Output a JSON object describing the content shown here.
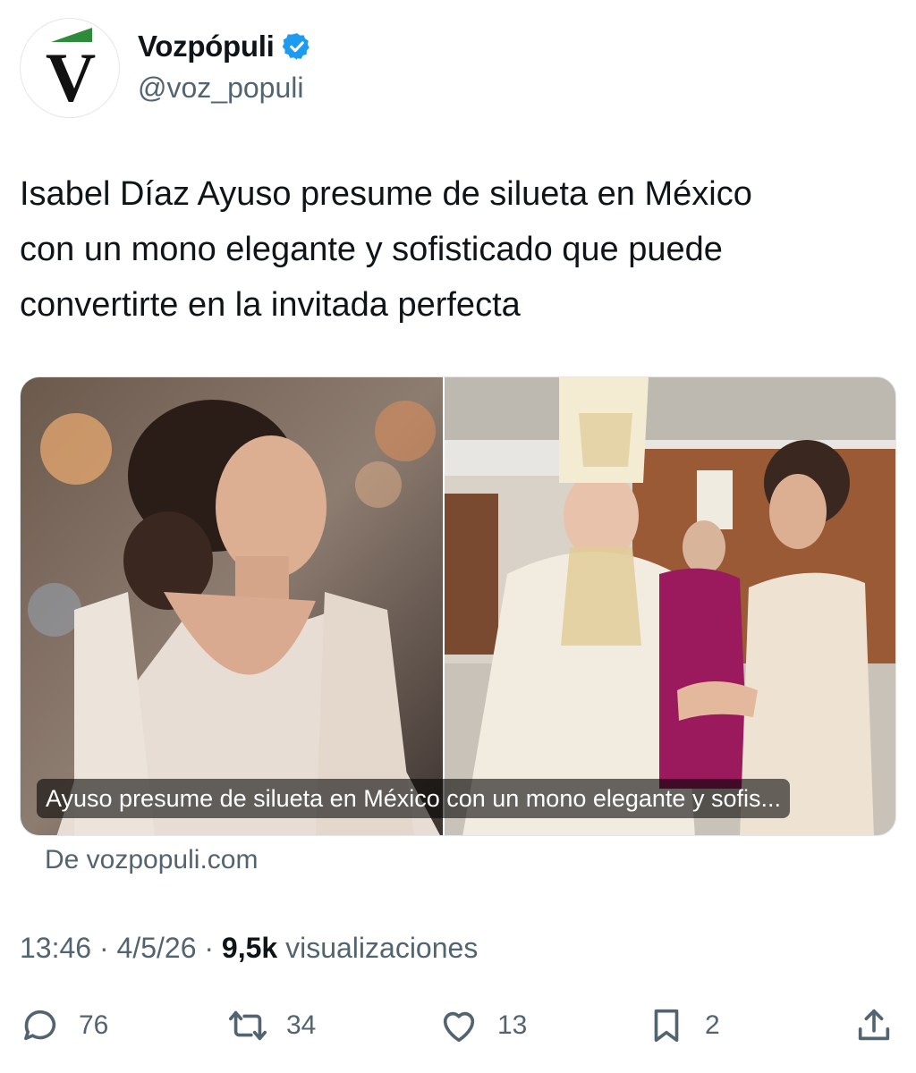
{
  "account": {
    "display_name": "Vozpópuli",
    "handle": "@voz_populi",
    "verified_icon": "verified-badge-icon",
    "avatar_letter": "V",
    "brand_color": "#111111",
    "accent_color": "#2e8b3a",
    "verified_color": "#1d9bf0"
  },
  "tweet": {
    "lines": [
      "Isabel Díaz Ayuso presume de silueta en México",
      "con un mono elegante y sofisticado que puede",
      "convertirte en la invitada perfecta"
    ]
  },
  "card": {
    "caption": "Ayuso presume de silueta en México con un mono elegante y sofis...",
    "source": "De vozpopuli.com"
  },
  "meta": {
    "time": "13:46",
    "date": "4/5/26",
    "views_count": "9,5k",
    "views_label": "visualizaciones"
  },
  "actions": {
    "replies": "76",
    "reposts": "34",
    "likes": "13",
    "bookmarks": "2"
  }
}
